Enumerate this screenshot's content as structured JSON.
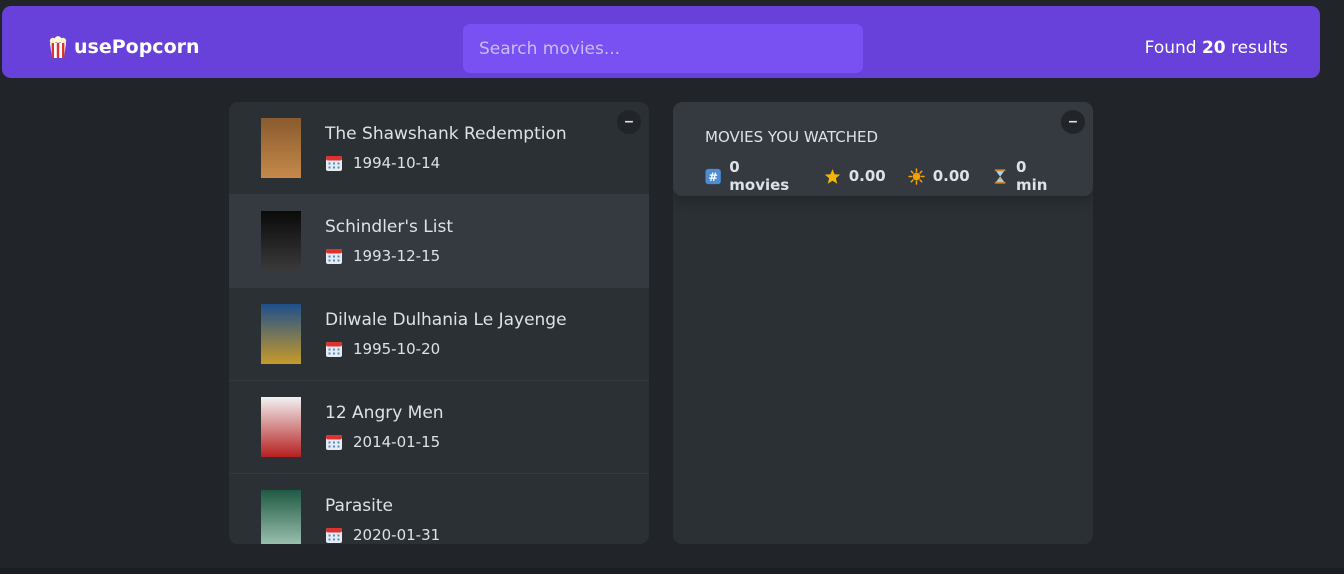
{
  "app": {
    "logo_text": "usePopcorn",
    "logo_icon": "popcorn-icon"
  },
  "search": {
    "placeholder": "Search movies...",
    "value": ""
  },
  "results": {
    "prefix": "Found",
    "count": "20",
    "suffix": "results"
  },
  "list_box": {
    "toggle_label": "–",
    "movies": [
      {
        "title": "The Shawshank Redemption",
        "date": "1994-10-14",
        "poster_colors": [
          "#8a5a2e",
          "#c58a4a"
        ],
        "active": false
      },
      {
        "title": "Schindler's List",
        "date": "1993-12-15",
        "poster_colors": [
          "#0a0a0a",
          "#3a3a3a"
        ],
        "active": true
      },
      {
        "title": "Dilwale Dulhania Le Jayenge",
        "date": "1995-10-20",
        "poster_colors": [
          "#1d4f8c",
          "#c89a2a"
        ],
        "active": false
      },
      {
        "title": "12 Angry Men",
        "date": "2014-01-15",
        "poster_colors": [
          "#f2f2f2",
          "#b52020"
        ],
        "active": false
      },
      {
        "title": "Parasite",
        "date": "2020-01-31",
        "poster_colors": [
          "#1f5a44",
          "#a7c9b8"
        ],
        "active": false
      }
    ]
  },
  "watched_box": {
    "toggle_label": "–",
    "title": "MOVIES YOU WATCHED",
    "stats": {
      "movies": "0 movies",
      "imdb_rating": "0.00",
      "user_rating": "0.00",
      "runtime": "0 min"
    }
  },
  "colors": {
    "accent": "#6741d9",
    "search_bg": "#7950f2",
    "background": "#212529",
    "box_bg": "#2b3035",
    "active_row": "#343a40"
  }
}
